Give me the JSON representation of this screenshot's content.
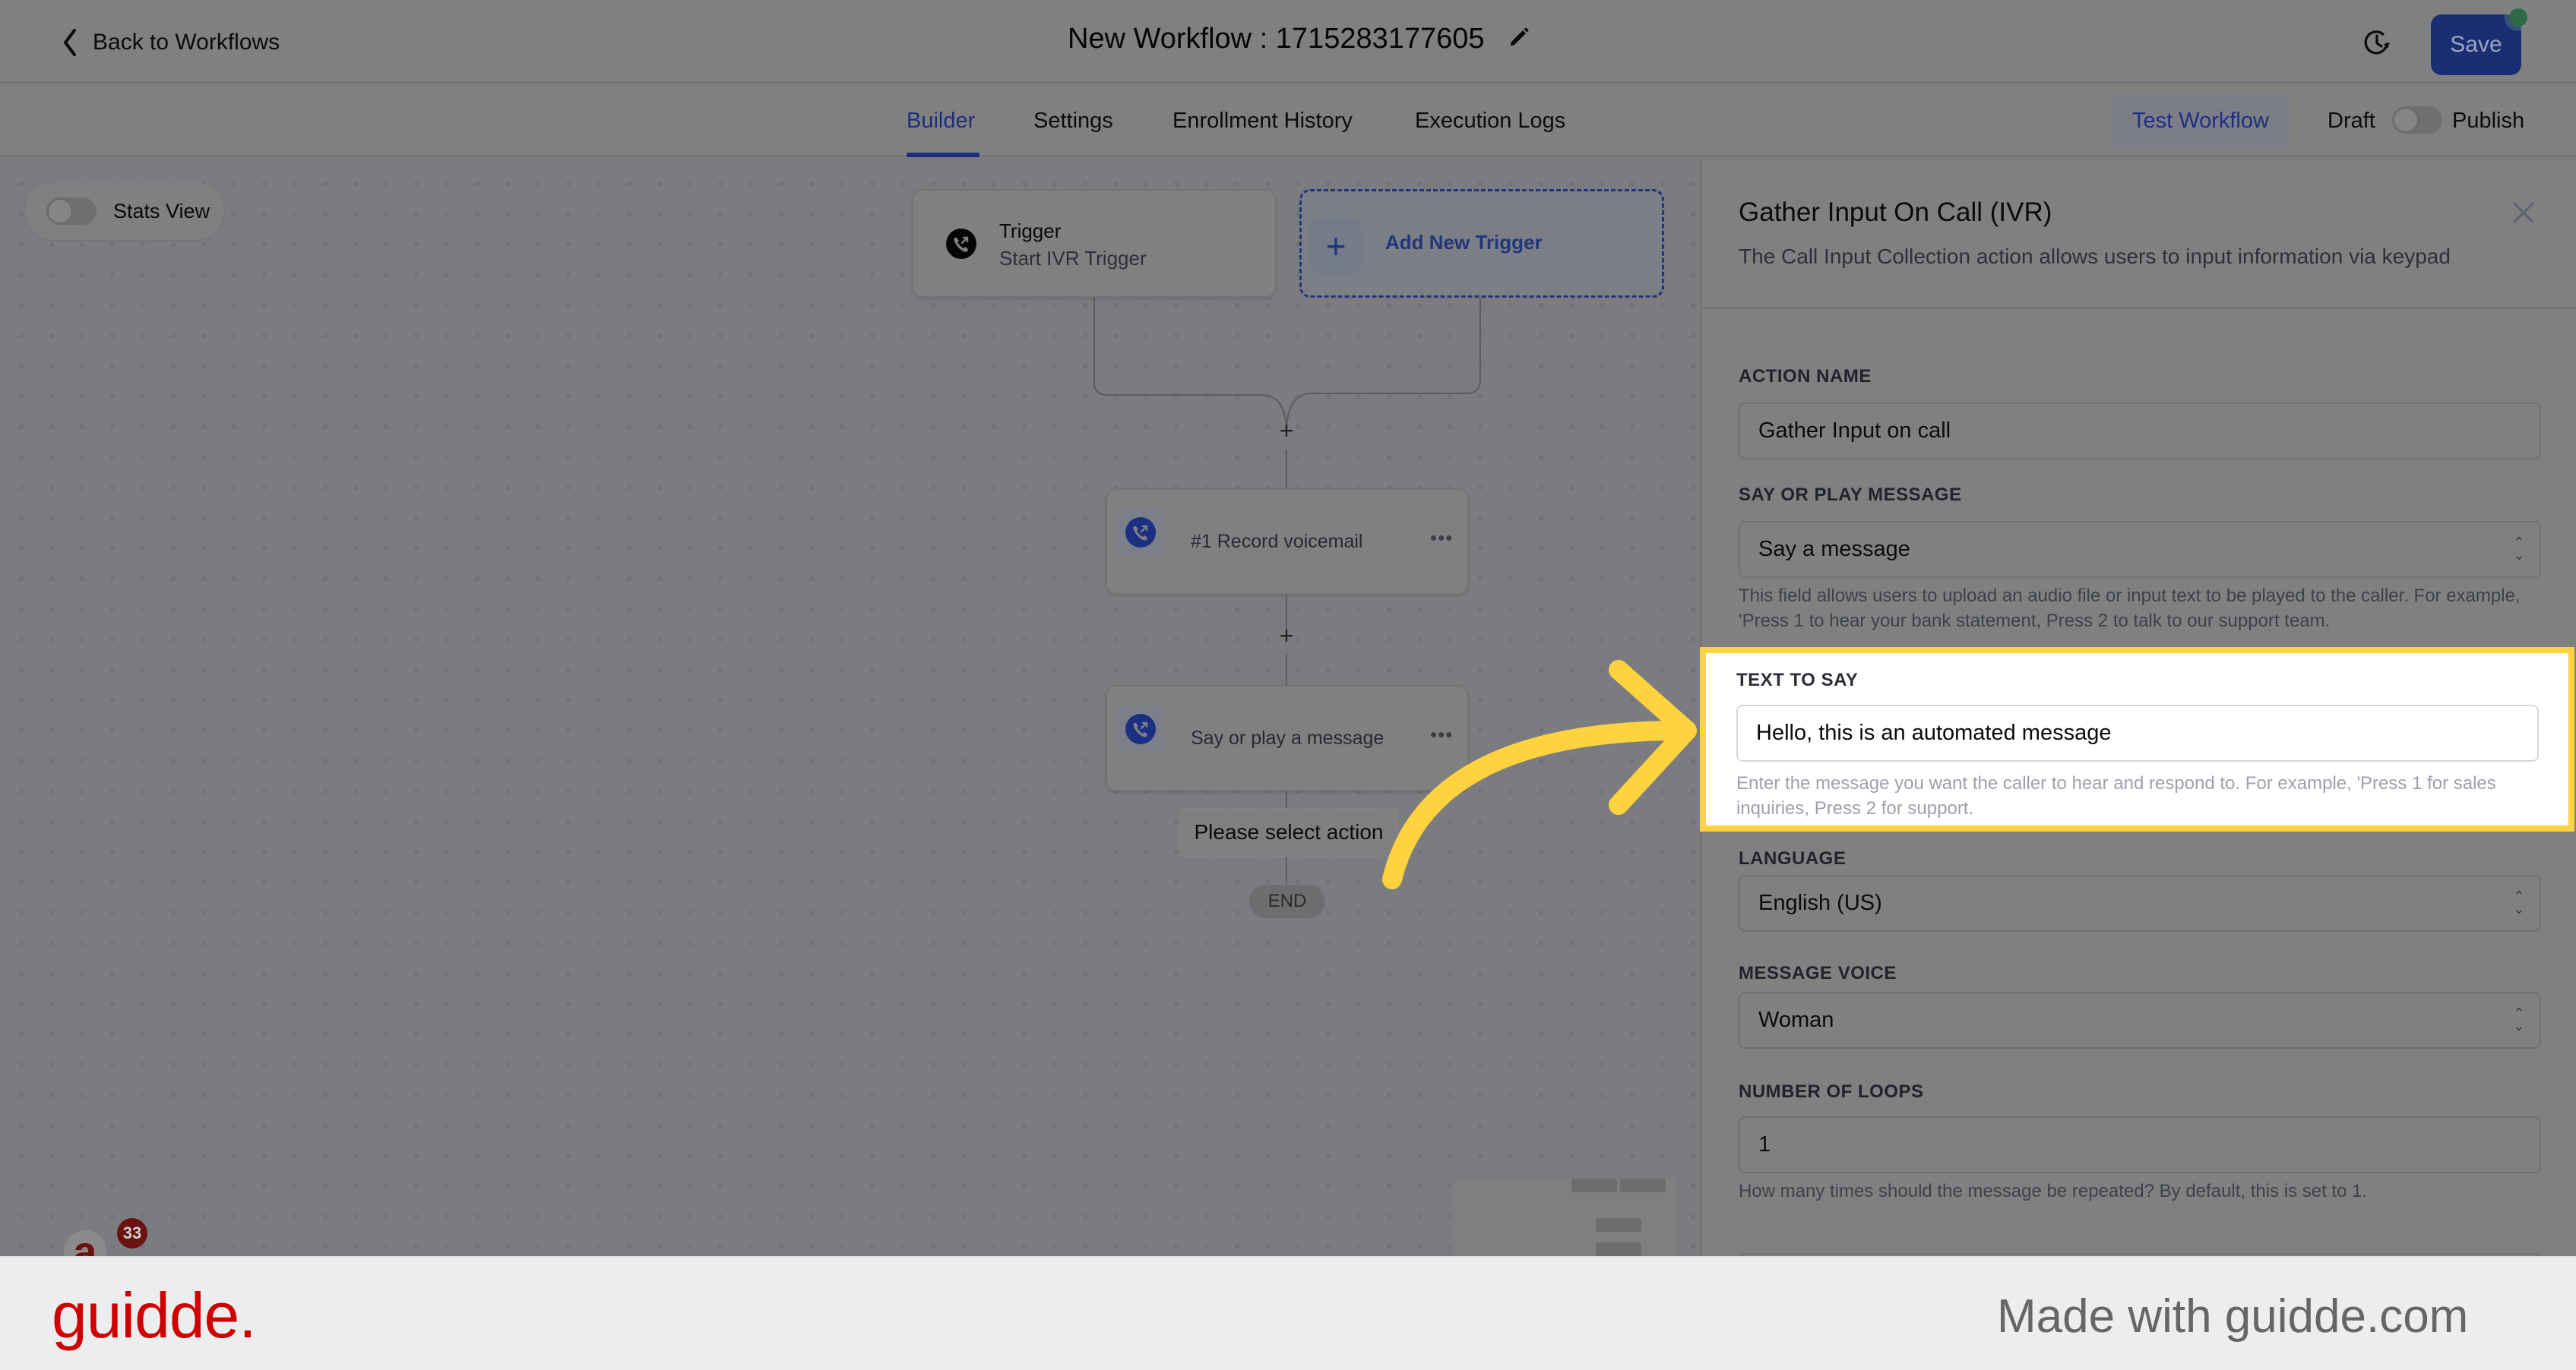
{
  "header": {
    "back_label": "Back to Workflows",
    "workflow_title": "New Workflow : 1715283177605",
    "save_label": "Save"
  },
  "tabs": [
    {
      "label": "Builder",
      "active": true
    },
    {
      "label": "Settings",
      "active": false
    },
    {
      "label": "Enrollment History",
      "active": false
    },
    {
      "label": "Execution Logs",
      "active": false
    }
  ],
  "toolbar": {
    "test_workflow_label": "Test Workflow",
    "draft_label": "Draft",
    "publish_label": "Publish",
    "publish_toggle_on": false
  },
  "canvas": {
    "stats_view_label": "Stats View",
    "stats_view_on": false,
    "trigger": {
      "title": "Trigger",
      "subtitle": "Start IVR Trigger"
    },
    "add_trigger_label": "Add New Trigger",
    "actions": [
      {
        "label": "#1 Record voicemail"
      },
      {
        "label": "Say or play a message"
      }
    ],
    "more_glyph": "•••",
    "select_action_label": "Please select action",
    "end_label": "END",
    "plus_glyph": "+"
  },
  "panel": {
    "title": "Gather Input On Call (IVR)",
    "description": "The Call Input Collection action allows users to input information via keypad",
    "fields": {
      "action_name": {
        "label": "ACTION NAME",
        "value": "Gather Input on call"
      },
      "say_or_play": {
        "label": "SAY OR PLAY MESSAGE",
        "value": "Say a message",
        "help": "This field allows users to upload an audio file or input text to be played to the caller. For example, 'Press 1 to hear your bank statement, Press 2 to talk to our support team."
      },
      "text_to_say": {
        "label": "TEXT TO SAY",
        "value": "Hello, this is an automated message",
        "help": "Enter the message you want the caller to hear and respond to. For example, 'Press 1 for sales inquiries, Press 2 for support."
      },
      "language": {
        "label": "LANGUAGE",
        "value": "English (US)"
      },
      "message_voice": {
        "label": "MESSAGE VOICE",
        "value": "Woman"
      },
      "number_of_loops": {
        "label": "NUMBER OF LOOPS",
        "value": "1",
        "help": "How many times should the message be repeated? By default, this is set to 1."
      }
    }
  },
  "notifications": {
    "avatar_letter": "a",
    "badge_count": "33"
  },
  "footer": {
    "logo": "guidde.",
    "tagline": "Made with guidde.com"
  },
  "colors": {
    "accent": "#1c2f7c",
    "highlight": "#ffd23f",
    "brand_red": "#d00000",
    "status_dot": "#2f6a48"
  }
}
